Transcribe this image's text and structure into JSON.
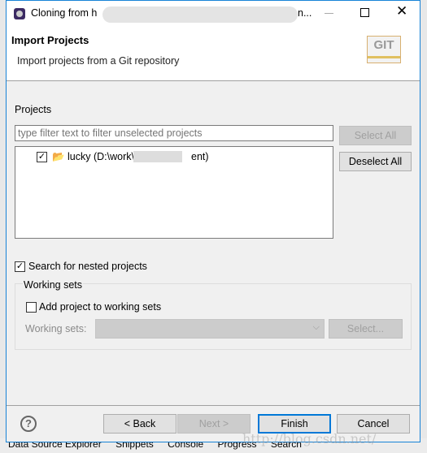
{
  "window": {
    "title": "Cloning from h",
    "title_suffix": "n..."
  },
  "header": {
    "title": "Import Projects",
    "subtitle": "Import projects from a Git repository",
    "logo_text": "GIT"
  },
  "projects": {
    "label": "Projects",
    "filter_placeholder": "type filter text to filter unselected projects",
    "items": [
      {
        "label": "lucky (D:\\work\\r",
        "label_suffix": "ent)",
        "checked": true
      }
    ],
    "select_all": "Select All",
    "deselect_all": "Deselect All"
  },
  "nested": {
    "label": "Search for nested projects",
    "checked": true
  },
  "working_sets": {
    "group_label": "Working sets",
    "add_label": "Add project to working sets",
    "add_checked": false,
    "field_label": "Working sets:",
    "select_button": "Select..."
  },
  "footer": {
    "back": "< Back",
    "next": "Next >",
    "finish": "Finish",
    "cancel": "Cancel"
  },
  "taskbar": {
    "items": [
      "Data Source Explorer",
      "Snippets",
      "Console",
      "Progress",
      "Search"
    ]
  },
  "watermark": "http://blog.csdn.net/"
}
